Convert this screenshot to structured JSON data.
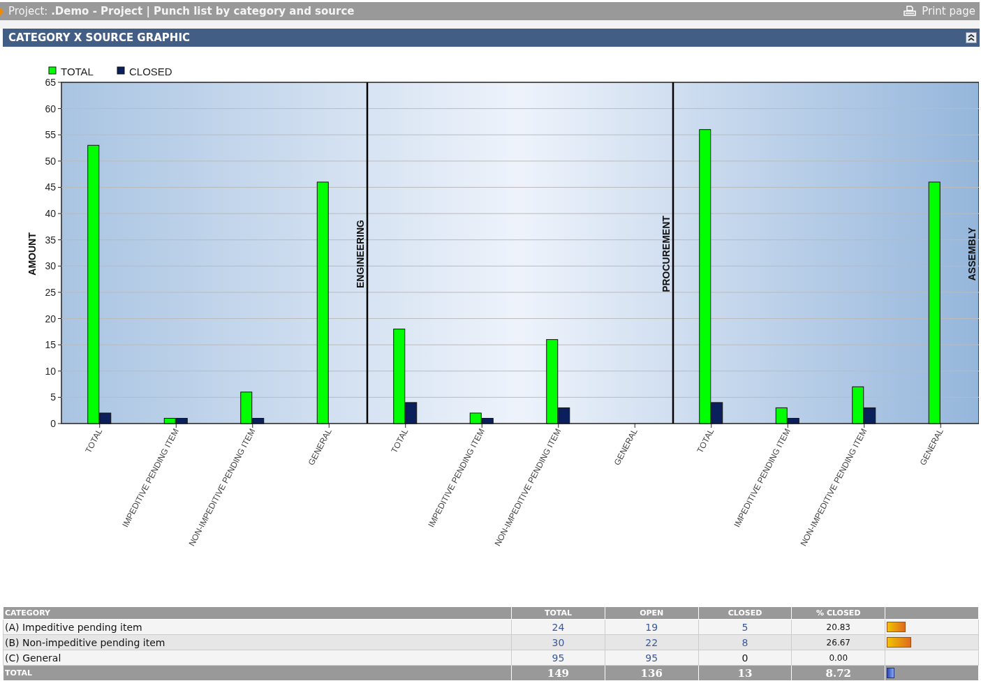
{
  "top_bar": {
    "title": "Project: **.Demo - Project | Punch list by category and source**",
    "print_link": "Print page"
  },
  "section": {
    "title": "CATEGORY X SOURCE GRAPHIC",
    "collapsed": false
  },
  "chart": {
    "chart_data": {
      "type": "bar",
      "ylabel": "AMOUNT",
      "ylim": [
        0,
        65
      ],
      "yticks": [
        0,
        5,
        10,
        15,
        20,
        25,
        30,
        35,
        40,
        45,
        50,
        55,
        60,
        65
      ],
      "grid": true,
      "legend": "top-left",
      "categories": [
        "TOTAL",
        "IMPEDITIVE PENDING ITEM",
        "NON-IMPEDITIVE PENDING ITEM",
        "GENERAL",
        "TOTAL",
        "IMPEDITIVE PENDING ITEM",
        "NON-IMPEDITIVE PENDING ITEM",
        "GENERAL",
        "TOTAL",
        "IMPEDITIVE PENDING ITEM",
        "NON-IMPEDITIVE PENDING ITEM",
        "GENERAL"
      ],
      "series": [
        {
          "name": "TOTAL",
          "color": "#00ff00",
          "values": [
            53,
            1,
            6,
            46,
            18,
            2,
            16,
            0,
            56,
            3,
            7,
            46
          ]
        },
        {
          "name": "CLOSED",
          "color": "#0a1f5c",
          "values": [
            2,
            1,
            1,
            0,
            4,
            1,
            3,
            0,
            4,
            1,
            3,
            0
          ]
        }
      ],
      "annotations": [
        "ENGINEERING",
        "PROCUREMENT",
        "ASSEMBLY"
      ]
    }
  },
  "table": {
    "columns": [
      "CATEGORY",
      "TOTAL",
      "OPEN",
      "CLOSED",
      "% CLOSED"
    ],
    "rows": [
      {
        "cells": [
          {
            "text": "(A) Impeditive pending item",
            "link": false
          },
          {
            "text": "24",
            "link": true
          },
          {
            "text": "19",
            "link": true
          },
          {
            "text": "5",
            "link": true
          },
          {
            "text": "20.83",
            "link": false
          }
        ],
        "level": 0.2083
      },
      {
        "cells": [
          {
            "text": "(B) Non-impeditive pending item",
            "link": false
          },
          {
            "text": "30",
            "link": true
          },
          {
            "text": "22",
            "link": true
          },
          {
            "text": "8",
            "link": true
          },
          {
            "text": "26.67",
            "link": false
          }
        ],
        "level": 0.2667
      },
      {
        "cells": [
          {
            "text": "(C) General",
            "link": false
          },
          {
            "text": "95",
            "link": true
          },
          {
            "text": "95",
            "link": true
          },
          {
            "text": "0",
            "link": false
          },
          {
            "text": "0.00",
            "link": false
          }
        ]
      }
    ],
    "total": {
      "cells": [
        "TOTAL",
        "149",
        "136",
        "13",
        "8.72"
      ],
      "level": 0.0872
    }
  }
}
